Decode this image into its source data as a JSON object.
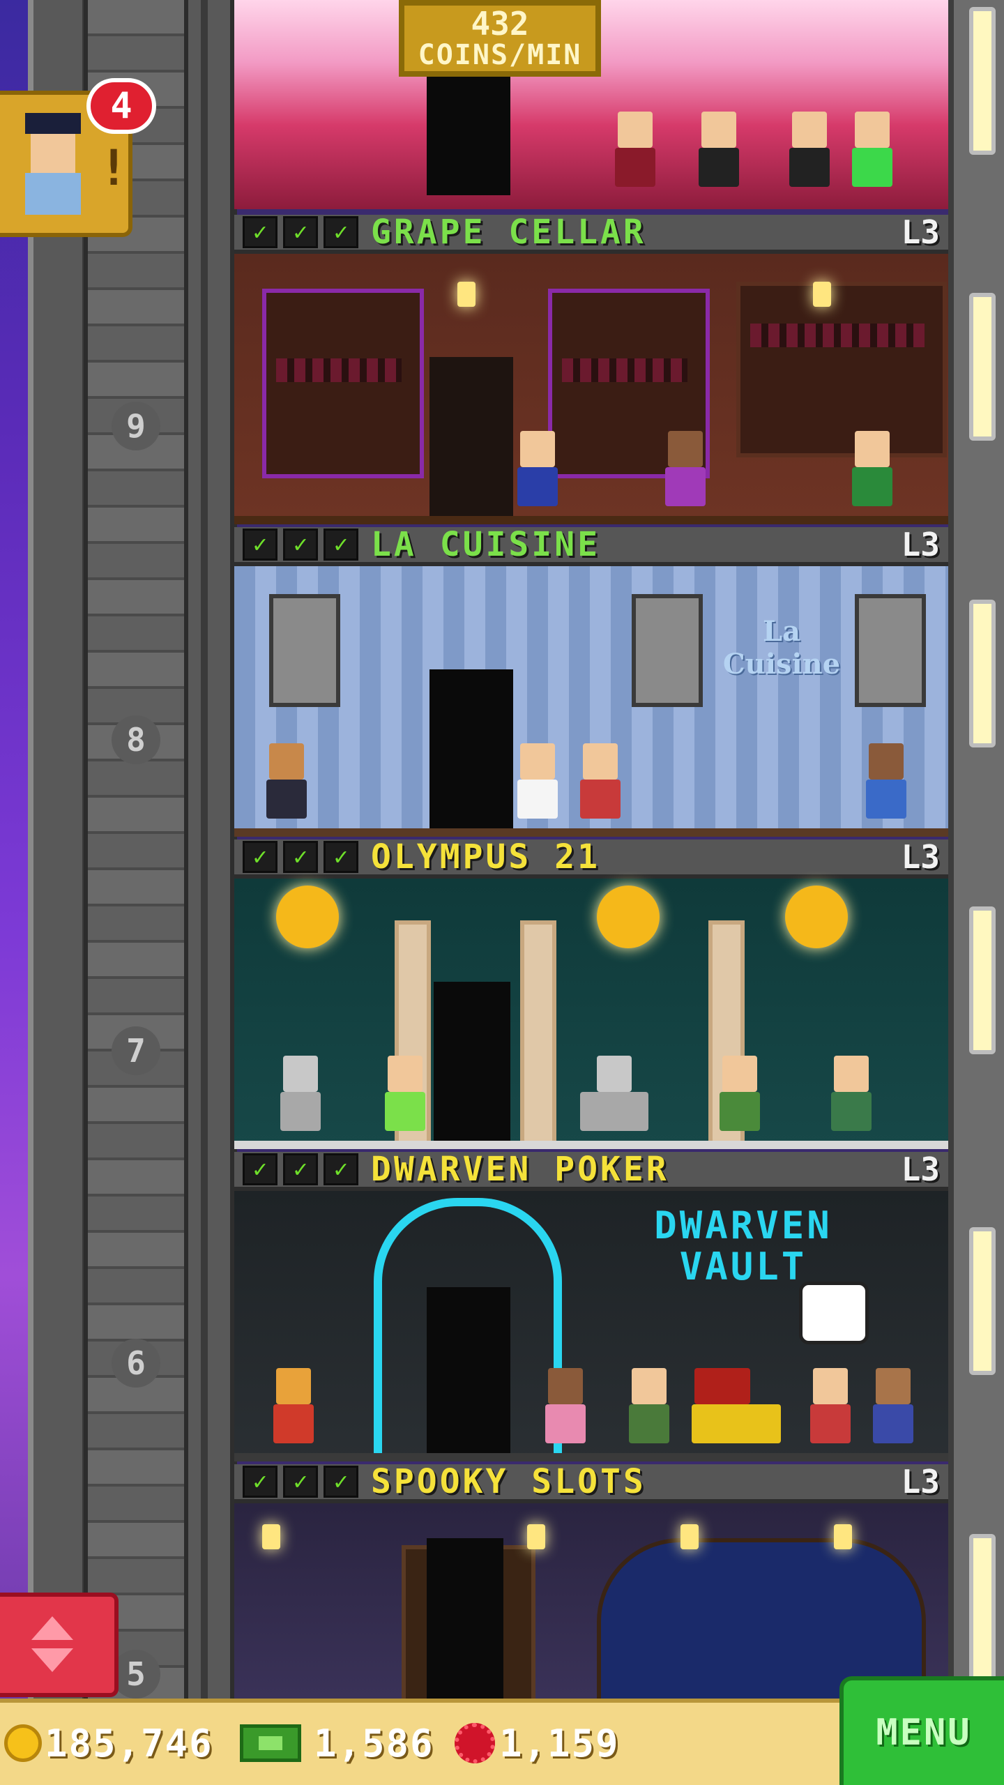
{
  "coins_per_min": {
    "value": "432",
    "label": "COINS/MIN"
  },
  "mission": {
    "badge_count": "4"
  },
  "floors": [
    {
      "name": "GRAPE CELLAR",
      "level": "L3",
      "number": "9",
      "name_color": "#7be04a",
      "stars": 3
    },
    {
      "name": "LA CUISINE",
      "level": "L3",
      "number": "8",
      "name_color": "#7be04a",
      "stars": 3
    },
    {
      "name": "OLYMPUS 21",
      "level": "L3",
      "number": "7",
      "name_color": "#f5e23a",
      "stars": 3
    },
    {
      "name": "DWARVEN POKER",
      "level": "L3",
      "number": "6",
      "name_color": "#f5e23a",
      "stars": 3
    },
    {
      "name": "SPOOKY SLOTS",
      "level": "L3",
      "number": "5",
      "name_color": "#f5e23a",
      "stars": 3
    }
  ],
  "scene_signs": {
    "la_cuisine": "La Cuisine",
    "dwarven_vault": "DWARVEN VAULT"
  },
  "status_bar": {
    "coins": "185,746",
    "bux": "1,586",
    "gems": "1,159",
    "menu_label": "MENU"
  },
  "icons": [
    "coin-icon",
    "bux-icon",
    "gem-icon",
    "elevator-updown-icon",
    "check-icon"
  ]
}
